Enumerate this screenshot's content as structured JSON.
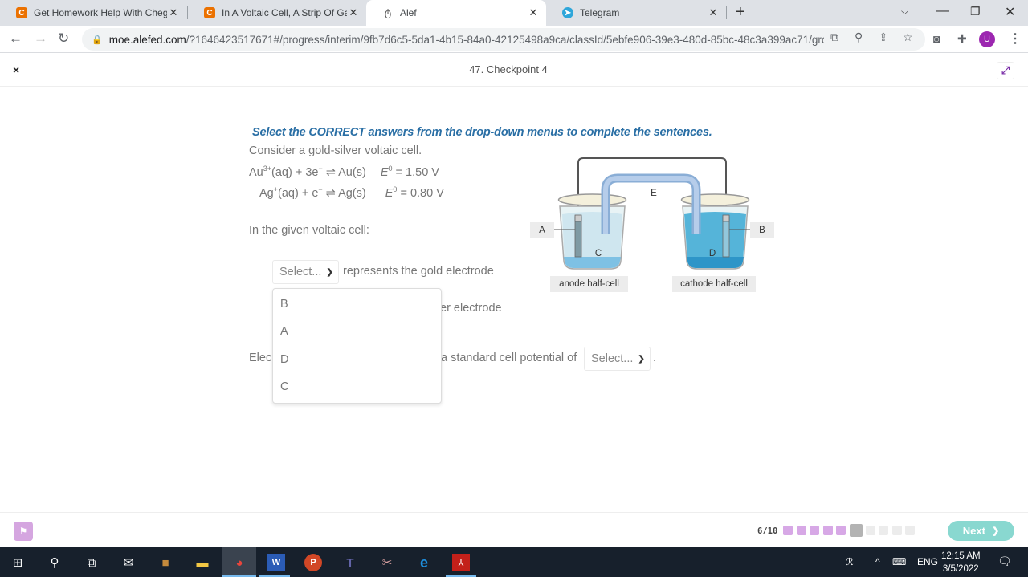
{
  "browser": {
    "tabs": [
      {
        "title": "Get Homework Help With Chegg",
        "icon": "chegg-icon",
        "active": false
      },
      {
        "title": "In A Voltaic Cell, A Strip Of Gallium",
        "icon": "chegg-icon",
        "active": false
      },
      {
        "title": "Alef",
        "icon": "alef-icon",
        "active": true
      },
      {
        "title": "Telegram",
        "icon": "telegram-icon",
        "active": false
      }
    ],
    "url_host": "moe.alefed.com",
    "url_path": "/?1646423517671#/progress/interim/9fb7d6c5-5da1-4b15-84a0-42125498a9ca/classId/5ebfe906-39e3-480d-85bc-48c3a399ac71/grou...",
    "profile_initial": "U"
  },
  "app": {
    "close_label": "×",
    "title": "47. Checkpoint 4"
  },
  "question": {
    "instruction": "Select the CORRECT answers from the drop-down menus to complete the sentences.",
    "intro": "Consider a gold-silver voltaic cell.",
    "eq1": {
      "left": "Au",
      "charge": "3+",
      "rest": "(aq) + 3e",
      "electron_sup": "−",
      "product": " ⇌ Au(s)",
      "potential_label": "E",
      "potential_sup": "0",
      "potential_value": " = 1.50 V"
    },
    "eq2": {
      "left": "Ag",
      "charge": "+",
      "rest": "(aq) + e",
      "electron_sup": "−",
      "product": " ⇌ Ag(s)",
      "potential_label": "E",
      "potential_sup": "0",
      "potential_value": " = 0.80 V"
    },
    "given": "In the given voltaic cell:",
    "sentence1_suffix": "represents the gold electrode",
    "sentence2_suffix_visible": "er electrode",
    "sentence3_prefix_visible": "Elec",
    "sentence3_mid": "a standard cell potential of",
    "sentence3_end": ".",
    "select_placeholder": "Select...",
    "dropdown_options": [
      "B",
      "A",
      "D",
      "C"
    ]
  },
  "diagram": {
    "labels": {
      "A": "A",
      "B": "B",
      "C": "C",
      "D": "D",
      "E": "E"
    },
    "anode_label": "anode half-cell",
    "cathode_label": "cathode half-cell"
  },
  "footer": {
    "progress_text": "6/10",
    "progress_current": 6,
    "progress_total": 10,
    "next_label": "Next",
    "colors": {
      "done": "#d7a8e6",
      "current": "#b3b3b3",
      "todo": "#ececec",
      "next": "#89d8d0"
    }
  },
  "taskbar": {
    "language": "ENG",
    "time": "12:15 AM",
    "date": "3/5/2022"
  }
}
